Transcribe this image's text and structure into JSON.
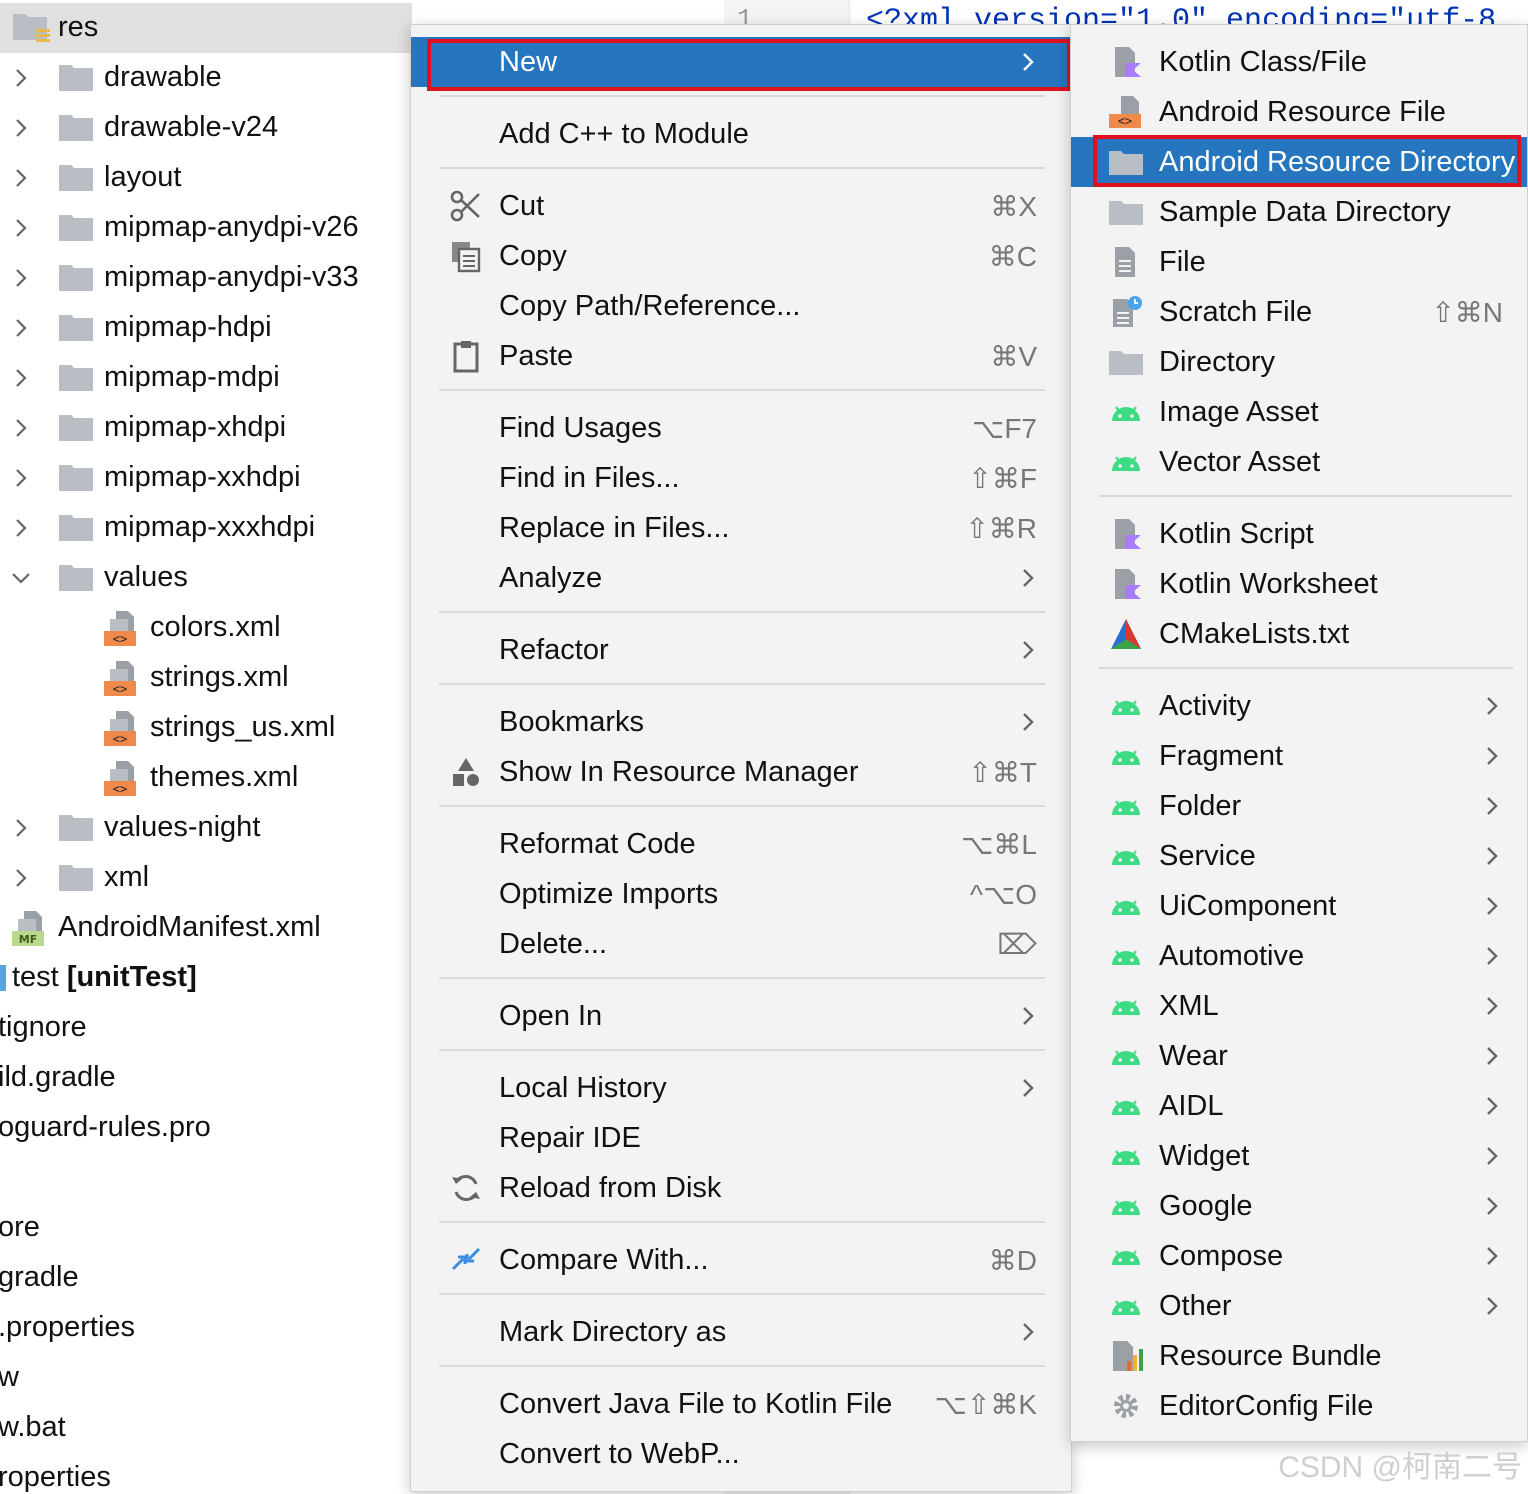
{
  "editor": {
    "line_number": "1",
    "code_snippet": "<?xml version=\"1.0\" encoding=\"utf-8"
  },
  "tree": {
    "items": [
      {
        "label": "res",
        "type": "res-folder",
        "selected": true
      },
      {
        "label": "drawable",
        "type": "folder",
        "expanded": false
      },
      {
        "label": "drawable-v24",
        "type": "folder",
        "expanded": false
      },
      {
        "label": "layout",
        "type": "folder",
        "expanded": false
      },
      {
        "label": "mipmap-anydpi-v26",
        "type": "folder",
        "expanded": false
      },
      {
        "label": "mipmap-anydpi-v33",
        "type": "folder",
        "expanded": false
      },
      {
        "label": "mipmap-hdpi",
        "type": "folder",
        "expanded": false
      },
      {
        "label": "mipmap-mdpi",
        "type": "folder",
        "expanded": false
      },
      {
        "label": "mipmap-xhdpi",
        "type": "folder",
        "expanded": false
      },
      {
        "label": "mipmap-xxhdpi",
        "type": "folder",
        "expanded": false
      },
      {
        "label": "mipmap-xxxhdpi",
        "type": "folder",
        "expanded": false
      },
      {
        "label": "values",
        "type": "folder",
        "expanded": true
      },
      {
        "label": "colors.xml",
        "type": "xml-file"
      },
      {
        "label": "strings.xml",
        "type": "xml-file"
      },
      {
        "label": "strings_us.xml",
        "type": "xml-file"
      },
      {
        "label": "themes.xml",
        "type": "xml-file"
      },
      {
        "label": "values-night",
        "type": "folder",
        "expanded": false
      },
      {
        "label": "xml",
        "type": "folder",
        "expanded": false
      },
      {
        "label": "AndroidManifest.xml",
        "type": "manifest-file"
      },
      {
        "label": "test",
        "label_bold": "[unitTest]",
        "type": "test-root"
      },
      {
        "label": "tignore",
        "type": "plain"
      },
      {
        "label": "ild.gradle",
        "type": "plain"
      },
      {
        "label": "oguard-rules.pro",
        "type": "plain"
      },
      {
        "label": "",
        "type": "plain"
      },
      {
        "label": "ore",
        "type": "plain"
      },
      {
        "label": "gradle",
        "type": "plain"
      },
      {
        "label": ".properties",
        "type": "plain"
      },
      {
        "label": "w",
        "type": "plain"
      },
      {
        "label": "w.bat",
        "type": "plain"
      },
      {
        "label": "roperties",
        "type": "plain"
      }
    ]
  },
  "context_menu": {
    "items": [
      {
        "label": "New",
        "shortcut": "",
        "submenu": true,
        "highlighted": true,
        "icon": ""
      },
      {
        "label": "Add C++ to Module",
        "shortcut": "",
        "submenu": false,
        "icon": ""
      },
      {
        "label": "Cut",
        "shortcut": "⌘X",
        "submenu": false,
        "icon": "scissors-icon"
      },
      {
        "label": "Copy",
        "shortcut": "⌘C",
        "submenu": false,
        "icon": "copy-icon"
      },
      {
        "label": "Copy Path/Reference...",
        "shortcut": "",
        "submenu": false,
        "icon": ""
      },
      {
        "label": "Paste",
        "shortcut": "⌘V",
        "submenu": false,
        "icon": "clipboard-icon"
      },
      {
        "label": "Find Usages",
        "shortcut": "⌥F7",
        "submenu": false,
        "icon": ""
      },
      {
        "label": "Find in Files...",
        "shortcut": "⇧⌘F",
        "submenu": false,
        "icon": ""
      },
      {
        "label": "Replace in Files...",
        "shortcut": "⇧⌘R",
        "submenu": false,
        "icon": ""
      },
      {
        "label": "Analyze",
        "shortcut": "",
        "submenu": true,
        "icon": ""
      },
      {
        "label": "Refactor",
        "shortcut": "",
        "submenu": true,
        "icon": ""
      },
      {
        "label": "Bookmarks",
        "shortcut": "",
        "submenu": true,
        "icon": ""
      },
      {
        "label": "Show In Resource Manager",
        "shortcut": "⇧⌘T",
        "submenu": false,
        "icon": "resource-manager-icon"
      },
      {
        "label": "Reformat Code",
        "shortcut": "⌥⌘L",
        "submenu": false,
        "icon": ""
      },
      {
        "label": "Optimize Imports",
        "shortcut": "^⌥O",
        "submenu": false,
        "icon": ""
      },
      {
        "label": "Delete...",
        "shortcut": "⌦",
        "submenu": false,
        "icon": ""
      },
      {
        "label": "Open In",
        "shortcut": "",
        "submenu": true,
        "icon": ""
      },
      {
        "label": "Local History",
        "shortcut": "",
        "submenu": true,
        "icon": ""
      },
      {
        "label": "Repair IDE",
        "shortcut": "",
        "submenu": false,
        "icon": ""
      },
      {
        "label": "Reload from Disk",
        "shortcut": "",
        "submenu": false,
        "icon": "reload-icon"
      },
      {
        "label": "Compare With...",
        "shortcut": "⌘D",
        "submenu": false,
        "icon": "compare-icon"
      },
      {
        "label": "Mark Directory as",
        "shortcut": "",
        "submenu": true,
        "icon": ""
      },
      {
        "label": "Convert Java File to Kotlin File",
        "shortcut": "⌥⇧⌘K",
        "submenu": false,
        "icon": ""
      },
      {
        "label": "Convert to WebP...",
        "shortcut": "",
        "submenu": false,
        "icon": ""
      }
    ]
  },
  "new_submenu": {
    "items": [
      {
        "label": "Kotlin Class/File",
        "icon": "kotlin-file-icon",
        "shortcut": "",
        "submenu": false
      },
      {
        "label": "Android Resource File",
        "icon": "android-resource-file-icon",
        "shortcut": "",
        "submenu": false
      },
      {
        "label": "Android Resource Directory",
        "icon": "folder-icon",
        "shortcut": "",
        "submenu": false,
        "highlighted": true
      },
      {
        "label": "Sample Data Directory",
        "icon": "folder-icon",
        "shortcut": "",
        "submenu": false
      },
      {
        "label": "File",
        "icon": "file-icon",
        "shortcut": "",
        "submenu": false
      },
      {
        "label": "Scratch File",
        "icon": "scratch-file-icon",
        "shortcut": "⇧⌘N",
        "submenu": false
      },
      {
        "label": "Directory",
        "icon": "folder-icon",
        "shortcut": "",
        "submenu": false
      },
      {
        "label": "Image Asset",
        "icon": "android-icon",
        "shortcut": "",
        "submenu": false
      },
      {
        "label": "Vector Asset",
        "icon": "android-icon",
        "shortcut": "",
        "submenu": false
      },
      {
        "label": "Kotlin Script",
        "icon": "kotlin-script-icon",
        "shortcut": "",
        "submenu": false
      },
      {
        "label": "Kotlin Worksheet",
        "icon": "kotlin-script-icon",
        "shortcut": "",
        "submenu": false
      },
      {
        "label": "CMakeLists.txt",
        "icon": "cmake-icon",
        "shortcut": "",
        "submenu": false
      },
      {
        "label": "Activity",
        "icon": "android-icon",
        "shortcut": "",
        "submenu": true
      },
      {
        "label": "Fragment",
        "icon": "android-icon",
        "shortcut": "",
        "submenu": true
      },
      {
        "label": "Folder",
        "icon": "android-icon",
        "shortcut": "",
        "submenu": true
      },
      {
        "label": "Service",
        "icon": "android-icon",
        "shortcut": "",
        "submenu": true
      },
      {
        "label": "UiComponent",
        "icon": "android-icon",
        "shortcut": "",
        "submenu": true
      },
      {
        "label": "Automotive",
        "icon": "android-icon",
        "shortcut": "",
        "submenu": true
      },
      {
        "label": "XML",
        "icon": "android-icon",
        "shortcut": "",
        "submenu": true
      },
      {
        "label": "Wear",
        "icon": "android-icon",
        "shortcut": "",
        "submenu": true
      },
      {
        "label": "AIDL",
        "icon": "android-icon",
        "shortcut": "",
        "submenu": true
      },
      {
        "label": "Widget",
        "icon": "android-icon",
        "shortcut": "",
        "submenu": true
      },
      {
        "label": "Google",
        "icon": "android-icon",
        "shortcut": "",
        "submenu": true
      },
      {
        "label": "Compose",
        "icon": "android-icon",
        "shortcut": "",
        "submenu": true
      },
      {
        "label": "Other",
        "icon": "android-icon",
        "shortcut": "",
        "submenu": true
      },
      {
        "label": "Resource Bundle",
        "icon": "resource-bundle-icon",
        "shortcut": "",
        "submenu": false
      },
      {
        "label": "EditorConfig File",
        "icon": "gear-icon",
        "shortcut": "",
        "submenu": false
      }
    ]
  },
  "watermark": "CSDN @柯南二号",
  "colors": {
    "highlight": "#2675bf",
    "annotation_red": "#e0101f",
    "android_green": "#3ddc84",
    "xml_orange": "#f08a4b",
    "folder_gray": "#b9bec4"
  }
}
